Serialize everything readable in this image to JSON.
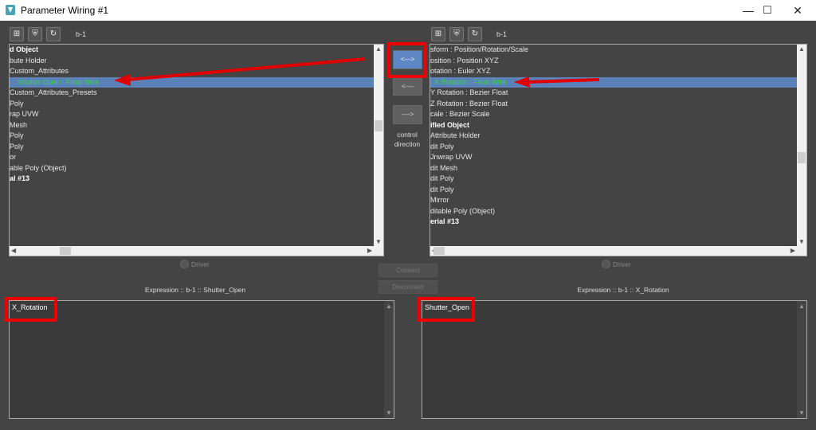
{
  "window": {
    "title": "Parameter Wiring #1",
    "controls": {
      "minimize": "—",
      "maximize": "☐",
      "close": "✕"
    }
  },
  "left": {
    "object": "b-1",
    "tree": [
      {
        "text": "d Object",
        "bold": true
      },
      {
        "text": "bute Holder"
      },
      {
        "text": "Custom_Attributes"
      },
      {
        "text": "Shutter Open : Float Wire",
        "selected": true
      },
      {
        "text": "Custom_Attributes_Presets"
      },
      {
        "text": "Poly"
      },
      {
        "text": "rap UVW"
      },
      {
        "text": "Mesh"
      },
      {
        "text": "Poly"
      },
      {
        "text": "Poly"
      },
      {
        "text": "or"
      },
      {
        "text": "able Poly (Object)"
      },
      {
        "text": "al #13",
        "bold": true
      }
    ],
    "driver_label": "Driver",
    "expression_header": "Expression :: b-1 :: Shutter_Open",
    "expression": "X_Rotation"
  },
  "right": {
    "object": "b-1",
    "tree": [
      {
        "text": "sform : Position/Rotation/Scale"
      },
      {
        "text": "osition : Position XYZ"
      },
      {
        "text": "otation : Euler XYZ"
      },
      {
        "text": "X Rotation : Float Wire",
        "selected": true
      },
      {
        "text": "Y Rotation : Bezier Float"
      },
      {
        "text": "Z Rotation : Bezier Float"
      },
      {
        "text": "cale : Bezier Scale"
      },
      {
        "text": "ified Object",
        "bold": true
      },
      {
        "text": "Attribute Holder"
      },
      {
        "text": "dit Poly"
      },
      {
        "text": "Jnwrap UVW"
      },
      {
        "text": "dit Mesh"
      },
      {
        "text": "dit Poly"
      },
      {
        "text": "dit Poly"
      },
      {
        "text": "Mirror"
      },
      {
        "text": "ditable Poly (Object)"
      },
      {
        "text": "erial #13",
        "bold": true
      }
    ],
    "driver_label": "Driver",
    "expression_header": "Expression :: b-1 :: X_Rotation",
    "expression": "Shutter_Open"
  },
  "center": {
    "bidirectional": "<--->",
    "to_left": "<----",
    "to_right": "---->",
    "control_direction": "control\ndirection",
    "connect": "Connect",
    "disconnect": "Disconnect"
  },
  "colors": {
    "annotation": "#e00000",
    "selection": "#5a82b9",
    "selected_text": "#3fcf4f"
  }
}
